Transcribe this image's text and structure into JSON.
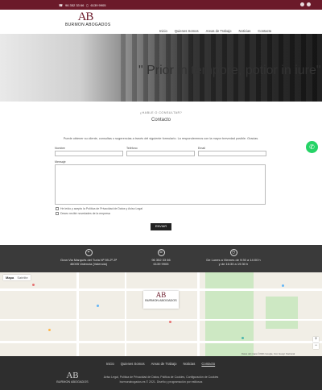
{
  "topbar": {
    "phone1": "96 352 33 66",
    "phone2": "6139 9905"
  },
  "header": {
    "logo_monogram": "AB",
    "logo_name": "BURMON ABOGADOS",
    "nav": [
      "Inicio",
      "Quienes Somos",
      "Areas de Trabajo",
      "Noticias",
      "Contacto"
    ]
  },
  "hero": {
    "quote": "\" Prior in tempore, potior in iure\""
  },
  "contact": {
    "kicker": "¿HABLE O CONSULTAR?",
    "title": "Contacto",
    "description": "Puede obtener su cliente, consultas o sugerencias a través del siguiente formulario. La responderemos con la mayor brevedad posible. Gracias.",
    "labels": {
      "name": "Nombre",
      "phone": "Teléfono",
      "email": "Email",
      "message": "Mensaje"
    },
    "privacy_check": "He leído y acepto la Política de Privacidad de Datos y Aviso Legal",
    "newsletter_check": "Deseo recibir novedades de la empresa",
    "send_label": "ENVIAR"
  },
  "info": {
    "address_line1": "Gran Via Marqués del Turia Nº 59-2º-3ª",
    "address_line2": "46005 Valencia (Valencia)",
    "phone_line1": "96 352 33 66",
    "phone_line2": "6139 9905",
    "hours_line1": "De Lunes a Viernes de 9:30 a 14:00 h",
    "hours_line2": "y de 16:30 a 19:30 h"
  },
  "map": {
    "type_label": "Mapa",
    "satellite_label": "Satélite",
    "attribution": "Datos del mapa ©2021 Google, Inst. Geogr. Nacional"
  },
  "footer": {
    "nav": [
      "Inicio",
      "Quienes Somos",
      "Areas de Trabajo",
      "Noticias",
      "Contacto"
    ],
    "logo_monogram": "AB",
    "logo_name": "BURMON ABOGADOS",
    "legal1": "Aviso Legal, Política de Privacidad de Datos, Política de Cookies, Configuración de Cookies",
    "legal2": "burmonabogados.es © 2021. Diseño y programación por estilosos"
  },
  "colors": {
    "brand": "#6b1a2a",
    "dark": "#2e2e2e",
    "whatsapp": "#25d366"
  }
}
